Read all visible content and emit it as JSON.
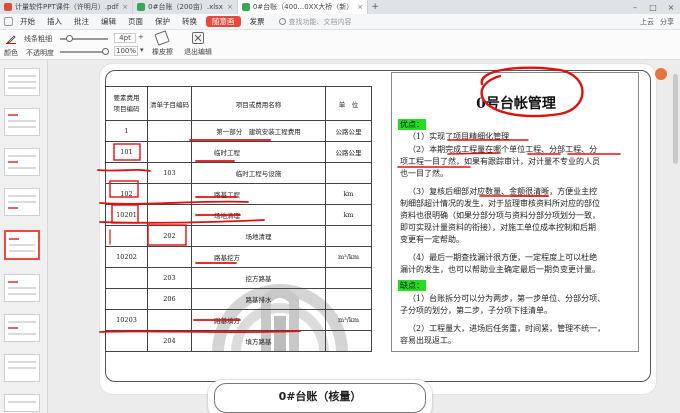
{
  "tabs": [
    {
      "label": "计量软件PPT课件（许明月）.pdf",
      "icon": "pdf-icon",
      "color": "#e04a3c",
      "active": false
    },
    {
      "label": "0#台账（200亩）.xlsx",
      "icon": "sheet-icon",
      "color": "#3aa757",
      "active": false
    },
    {
      "label": "0#台账（400...0XX大桥（新）",
      "icon": "sheet-icon",
      "color": "#3aa757",
      "active": true
    }
  ],
  "menu": {
    "items": [
      "开始",
      "插入",
      "批注",
      "编辑",
      "页面",
      "保护",
      "转换"
    ],
    "active": "随意画",
    "after": "发票",
    "search_placeholder": "查找功能、文档内容",
    "right_items": [
      "上云",
      "分享"
    ]
  },
  "toolbar": {
    "thickness_label": "线条粗细",
    "thickness_value": "4pt",
    "color_label": "颜色",
    "opacity_label": "不透明度",
    "opacity_value": "100%",
    "eraser_label": "橡皮擦",
    "exit_label": "退出编辑"
  },
  "table": {
    "header": [
      "要素费用\n项目编码",
      "清单子目编码",
      "项目或费用名称",
      "单　位"
    ],
    "rows": [
      [
        "1",
        "",
        "第一部分　建筑安装工程费用",
        "公路公里"
      ],
      [
        "101",
        "",
        "临时工程",
        "公路公里"
      ],
      [
        "",
        "103",
        "临时工程与设施",
        ""
      ],
      [
        "102",
        "",
        "路基工程",
        "km"
      ],
      [
        "10201",
        "",
        "场地清理",
        "km"
      ],
      [
        "",
        "202",
        "场地清理",
        ""
      ],
      [
        "10202",
        "",
        "路基挖方",
        "m³/km"
      ],
      [
        "",
        "203",
        "挖方路基",
        ""
      ],
      [
        "",
        "206",
        "路基排水",
        ""
      ],
      [
        "10203",
        "",
        "路基填方",
        "m³/km"
      ],
      [
        "",
        "204",
        "填方路基",
        ""
      ]
    ]
  },
  "panel": {
    "title": "0号台帐管理",
    "tag1": "优点：",
    "lines": [
      "（1）实现了项目精细化管理",
      "（2）本期完成工程量在哪个单位工程、分部工程、分",
      "项工程一目了然，如果有跟踪审计，对计量不专业的人员",
      "也一目了然。",
      "（3）复核后细部对应数量、金额很清晰，方便业主控",
      "制细部超计情况的发生，对于监理审核资料所对应的部位",
      "资料也很明确（如果分部分项与资料分部分项划分一致，",
      "即可实现计量资料的衔接），对施工单位成本控制和后期",
      "变更有一定帮助。",
      "（4）最后一期查找漏计很方便，一定程度上可以杜绝",
      "漏计的发生，也可以帮助业主确定最后一期负变更计量。"
    ],
    "tag2": "缺点：",
    "lines2": [
      "（1）台账拆分可以分为两步，第一步单位、分部分项、",
      "子分项的划分，第二步，子分项下挂清单。",
      "（2）工程量大，进场后任务重，时间紧，管理不统一，",
      "容易出现返工。"
    ]
  },
  "next_slide_title": "0#台账（核量）",
  "colors": {
    "accent": "#e8473c",
    "annotation": "#e01010",
    "highlight_green": "#22dd22"
  }
}
